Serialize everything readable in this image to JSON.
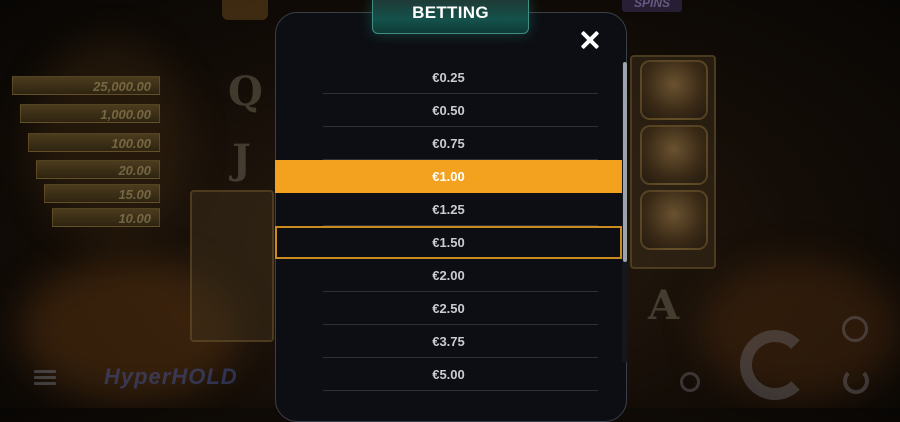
{
  "modal": {
    "title": "BETTING",
    "close_label": "✕",
    "selected_value": "€1.00",
    "bets": [
      "€0.25",
      "€0.50",
      "€0.75",
      "€1.00",
      "€1.25",
      "€1.50",
      "€2.00",
      "€2.50",
      "€3.75",
      "€5.00"
    ]
  },
  "background": {
    "jackpots": [
      "25,000.00",
      "1,000.00",
      "100.00",
      "20.00",
      "15.00",
      "10.00"
    ],
    "reel_letters": [
      "Q",
      "J",
      "A"
    ],
    "spins_label": "SPINS",
    "logo_text": "HyperHOLD"
  },
  "colors": {
    "accent": "#f3a21f",
    "modal_bg": "#0d0e13",
    "title_tab": "#14524b"
  },
  "icons": [
    "close-icon",
    "menu-icon",
    "coin-icon",
    "spin-icon",
    "autoplay-icon",
    "refresh-icon"
  ]
}
